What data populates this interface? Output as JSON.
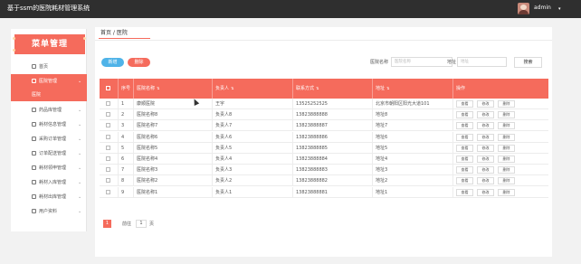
{
  "app": {
    "title": "基于ssm的医院耗材管理系统"
  },
  "user": {
    "name": "admin",
    "caret": "▾"
  },
  "sidebar": {
    "banner": "菜单管理",
    "items": [
      {
        "label": "首页",
        "icon": "home-icon",
        "chevron": ""
      },
      {
        "label": "医院管理",
        "icon": "flag-icon",
        "chevron": "⌄",
        "active": true
      },
      {
        "label": "药品库管理",
        "icon": "grid-icon",
        "chevron": "⌄"
      },
      {
        "label": "耗材信息管理",
        "icon": "grid-icon",
        "chevron": "⌄"
      },
      {
        "label": "采购订单管理",
        "icon": "grid-icon",
        "chevron": "⌄"
      },
      {
        "label": "订单配送管理",
        "icon": "pin-icon",
        "chevron": "⌄"
      },
      {
        "label": "耗材领申管理",
        "icon": "grid-icon",
        "chevron": "⌄"
      },
      {
        "label": "耗材入库管理",
        "icon": "layers-icon",
        "chevron": "⌄"
      },
      {
        "label": "耗材出库管理",
        "icon": "layers-icon",
        "chevron": "⌄"
      },
      {
        "label": "用户资料",
        "icon": "calendar-icon",
        "chevron": "⌄"
      }
    ],
    "submenu": "医院"
  },
  "breadcrumb": "首页 / 医院",
  "toolbar": {
    "add_label": "新增",
    "delete_label": "删除",
    "search_name_label": "医院名称",
    "search_name_placeholder": "医院名称",
    "search_addr_label": "地址",
    "search_addr_placeholder": "地址",
    "search_button": "搜索"
  },
  "table": {
    "columns": [
      "序号",
      "医院名称",
      "负责人",
      "联系方式",
      "地址",
      "操作"
    ],
    "sort_icon": "⇅",
    "actions": [
      "查看",
      "修改",
      "删除"
    ],
    "rows": [
      {
        "no": "1",
        "name": "康顺医院",
        "manager": "王宇",
        "phone": "13525252525",
        "address": "北京市朝阳区阳光大道101"
      },
      {
        "no": "2",
        "name": "医院名称8",
        "manager": "负责人8",
        "phone": "13823888888",
        "address": "地址8"
      },
      {
        "no": "3",
        "name": "医院名称7",
        "manager": "负责人7",
        "phone": "13823888887",
        "address": "地址7"
      },
      {
        "no": "4",
        "name": "医院名称6",
        "manager": "负责人6",
        "phone": "13823888886",
        "address": "地址6"
      },
      {
        "no": "5",
        "name": "医院名称5",
        "manager": "负责人5",
        "phone": "13823888885",
        "address": "地址5"
      },
      {
        "no": "6",
        "name": "医院名称4",
        "manager": "负责人4",
        "phone": "13823888884",
        "address": "地址4"
      },
      {
        "no": "7",
        "name": "医院名称3",
        "manager": "负责人3",
        "phone": "13823888883",
        "address": "地址3"
      },
      {
        "no": "8",
        "name": "医院名称2",
        "manager": "负责人2",
        "phone": "13823888882",
        "address": "地址2"
      },
      {
        "no": "9",
        "name": "医院名称1",
        "manager": "负责人1",
        "phone": "13823888881",
        "address": "地址1"
      }
    ]
  },
  "pagination": {
    "current": "1",
    "goto_label": "前往",
    "goto_value": "1",
    "page_suffix": "页"
  },
  "colors": {
    "accent": "#f56b5c",
    "add_button": "#4fb3e8",
    "topbar": "#2f2f2f"
  }
}
